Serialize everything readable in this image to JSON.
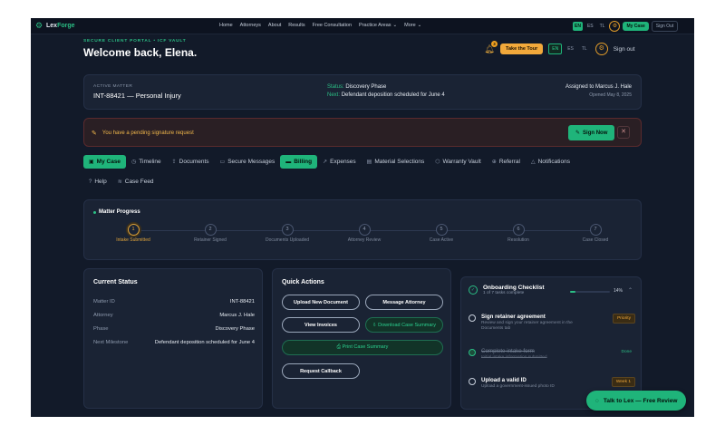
{
  "brand": {
    "name_a": "Lex",
    "name_b": "Forge"
  },
  "nav": {
    "links": [
      "Home",
      "Attorneys",
      "About",
      "Results",
      "Free Consultation",
      "Practice Areas",
      "More"
    ],
    "dropdown_caret": "⌄",
    "langs": [
      "EN",
      "ES",
      "TL"
    ],
    "mycase": "My Case",
    "signout": "Sign Out"
  },
  "header": {
    "eyebrow": "SECURE CLIENT PORTAL • ICF VAULT",
    "welcome": "Welcome back, Elena.",
    "notif_count": "3",
    "tour": "Take the Tour",
    "langs": [
      "EN",
      "ES",
      "TL"
    ],
    "signout": "Sign out"
  },
  "matter": {
    "label": "ACTIVE MATTER",
    "id_title": "INT-88421 — Personal Injury",
    "status_key": "Status:",
    "status_val": "Discovery Phase",
    "next_key": "Next:",
    "next_val": "Defendant deposition scheduled for June 4",
    "assigned": "Assigned to Marcus J. Hale",
    "opened": "Opened May 8, 2025"
  },
  "alert": {
    "text": "You have a pending signature request",
    "sign": "Sign Now",
    "close": "✕"
  },
  "tabs_row1": [
    {
      "label": "My Case",
      "icon": "▣"
    },
    {
      "label": "Timeline",
      "icon": "◷"
    },
    {
      "label": "Documents",
      "icon": "⇪"
    },
    {
      "label": "Secure Messages",
      "icon": "▭"
    },
    {
      "label": "Billing",
      "icon": "▬"
    },
    {
      "label": "Expenses",
      "icon": "↗"
    },
    {
      "label": "Material Selections",
      "icon": "▤"
    },
    {
      "label": "Warranty Vault",
      "icon": "⬡"
    },
    {
      "label": "Referral",
      "icon": "⊕"
    },
    {
      "label": "Notifications",
      "icon": "△"
    }
  ],
  "tabs_row2": [
    {
      "label": "Help",
      "icon": "?"
    },
    {
      "label": "Case Feed",
      "icon": "≋"
    }
  ],
  "progress": {
    "title": "Matter Progress",
    "steps": [
      {
        "n": "1",
        "label": "Intake Submitted"
      },
      {
        "n": "2",
        "label": "Retainer Signed"
      },
      {
        "n": "3",
        "label": "Documents Uploaded"
      },
      {
        "n": "4",
        "label": "Attorney Review"
      },
      {
        "n": "5",
        "label": "Case Active"
      },
      {
        "n": "6",
        "label": "Resolution"
      },
      {
        "n": "7",
        "label": "Case Closed"
      }
    ]
  },
  "current_status": {
    "title": "Current Status",
    "rows": [
      {
        "k": "Matter ID",
        "v": "INT-88421"
      },
      {
        "k": "Attorney",
        "v": "Marcus J. Hale"
      },
      {
        "k": "Phase",
        "v": "Discovery Phase"
      },
      {
        "k": "Next Milestone",
        "v": "Defendant deposition scheduled for June 4"
      }
    ]
  },
  "quick_actions": {
    "title": "Quick Actions",
    "upload": "Upload New Document",
    "message": "Message Attorney",
    "invoices": "View Invoices",
    "download": "⇩ Download Case Summary",
    "print": "⎙ Print Case Summary",
    "callback": "Request Callback"
  },
  "checklist": {
    "title": "Onboarding Checklist",
    "subtitle": "1 of 7 tasks complete",
    "percent": "14%",
    "progress_fraction": 0.14,
    "tasks": [
      {
        "title": "Sign retainer agreement",
        "desc": "Review and sign your retainer agreement in the Documents tab",
        "badge": "Priority"
      },
      {
        "title": "Complete intake form",
        "desc": "Initial intake information submitted",
        "badge": "Done"
      },
      {
        "title": "Upload a valid ID",
        "desc": "Upload a government-issued photo ID",
        "badge": "Week 1"
      }
    ]
  },
  "fab": {
    "label": "Talk to Lex — Free Review"
  }
}
